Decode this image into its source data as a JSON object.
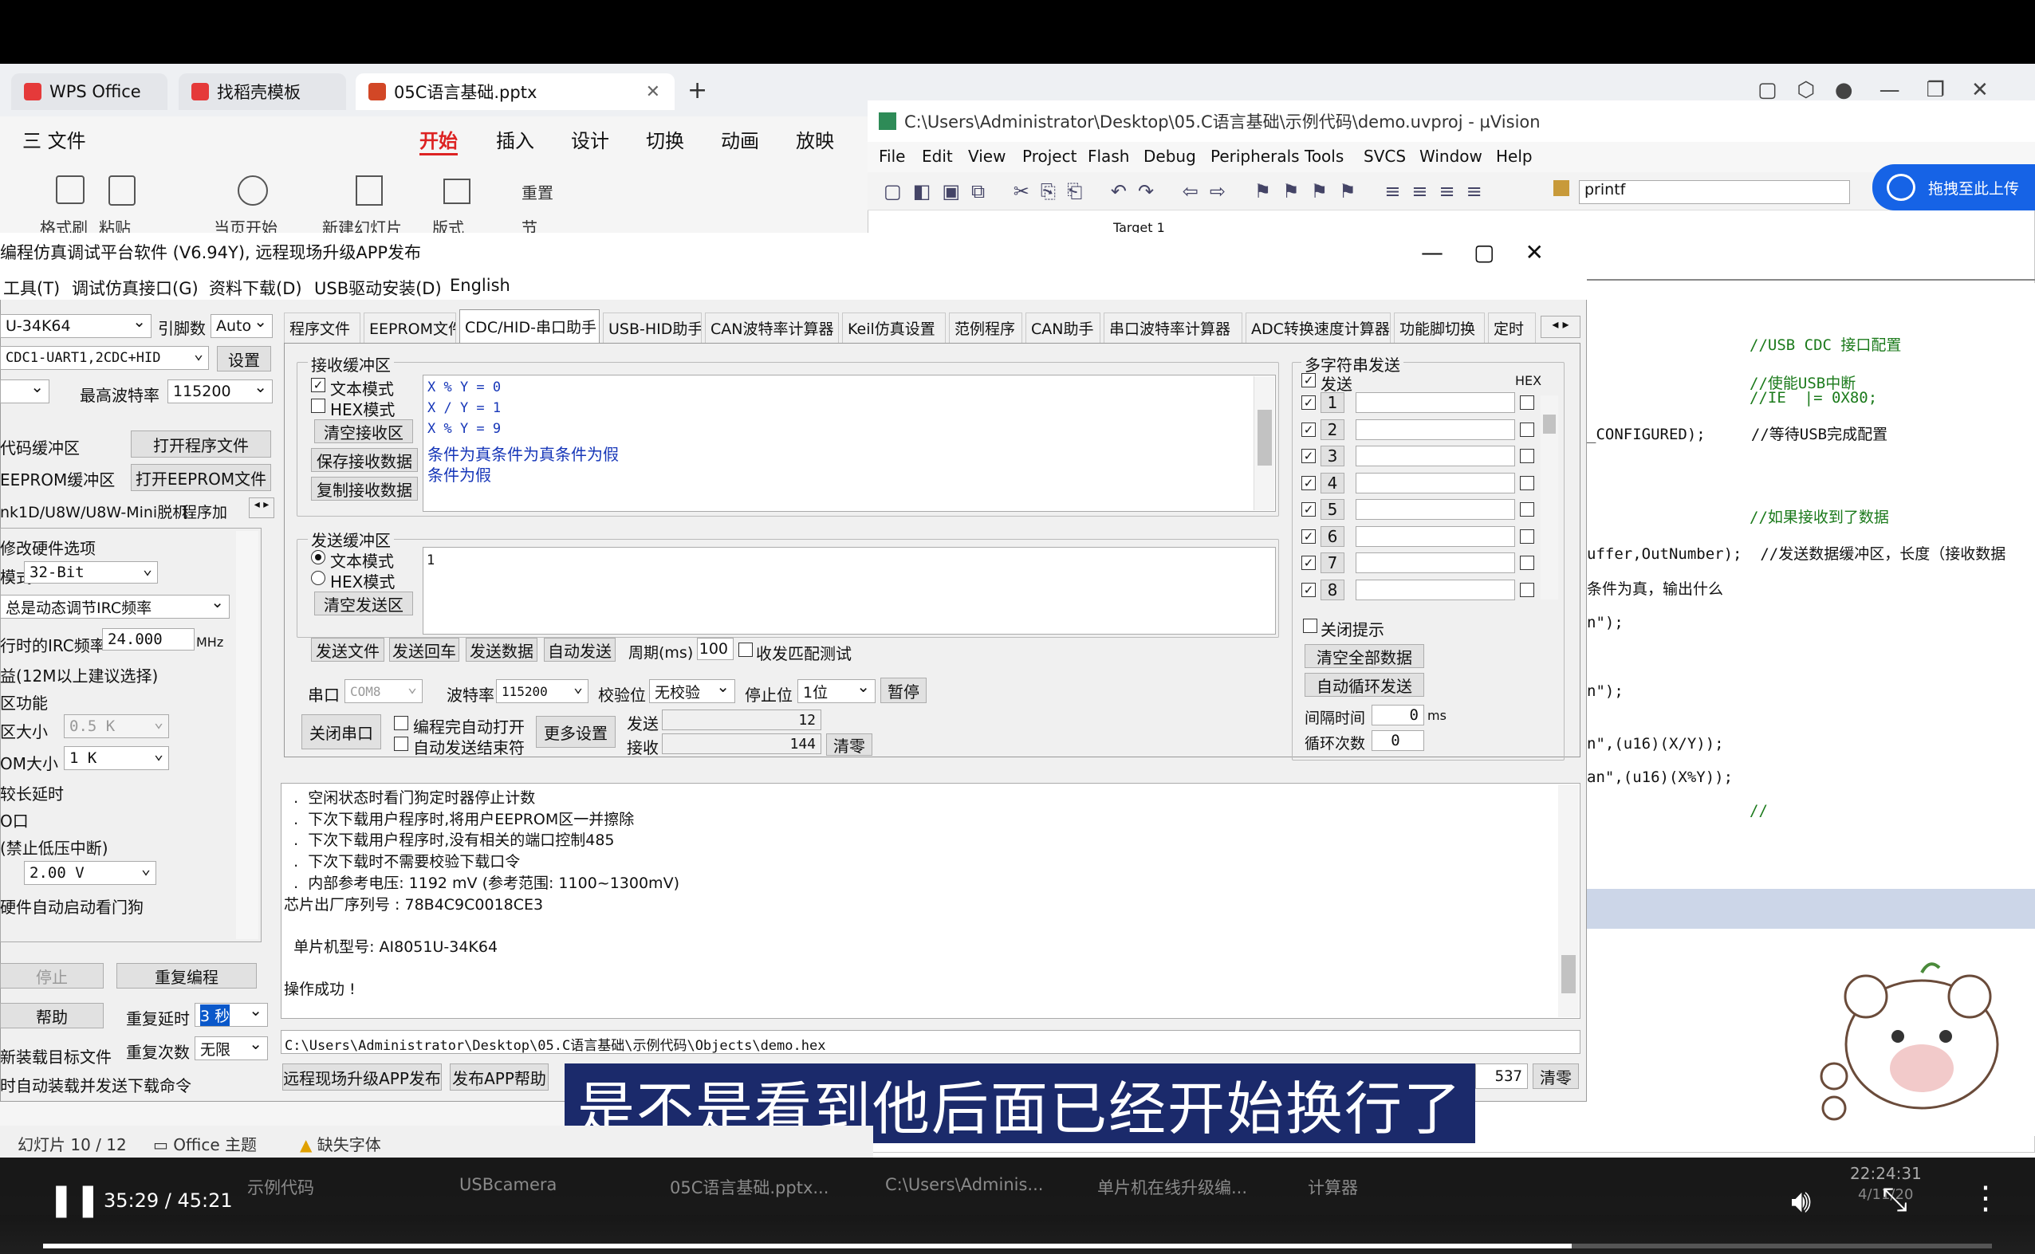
{
  "wps": {
    "tab1": "WPS Office",
    "tab2": "找稻壳模板",
    "tab3": "05C语言基础.pptx",
    "menu": [
      "三 文件",
      "开始",
      "插入",
      "设计",
      "切换",
      "动画",
      "放映"
    ],
    "ribbon": [
      "格式刷",
      "粘贴",
      "当页开始",
      "新建幻灯片",
      "版式",
      "重置",
      "节"
    ],
    "status_slide": "幻灯片 10 / 12",
    "status_theme": "Office 主题",
    "status_font": "缺失字体"
  },
  "uvision": {
    "title": "C:\\Users\\Administrator\\Desktop\\05.C语言基础\\示例代码\\demo.uvproj - µVision",
    "menu": [
      "File",
      "Edit",
      "View",
      "Project",
      "Flash",
      "Debug",
      "Peripherals",
      "Tools",
      "SVCS",
      "Window",
      "Help"
    ],
    "search": "printf",
    "target": "Target 1",
    "code": [
      {
        "text": "//USB CDC 接口配置",
        "cls": "cm"
      },
      {
        "text": "//使能USB中断",
        "cls": "cm"
      },
      {
        "text": "//IE  |= 0X80;",
        "cls": "cm"
      },
      {
        "text": "_CONFIGURED);     //等待USB完成配置",
        "cls": ""
      },
      {
        "text": "//如果接收到了数据",
        "cls": "cm"
      },
      {
        "text": "uffer,OutNumber);  //发送数据缓冲区，长度（接收数据",
        "cls": ""
      },
      {
        "text": "条件为真，输出什么",
        "cls": ""
      },
      {
        "text": "n\");",
        "cls": ""
      },
      {
        "text": "n\");",
        "cls": ""
      },
      {
        "text": "n\",(u16)(X/Y));",
        "cls": ""
      },
      {
        "text": "an\",(u16)(X%Y));",
        "cls": ""
      },
      {
        "text": "//",
        "cls": "cm"
      }
    ]
  },
  "baidu": "拖拽至此上传",
  "dialog": {
    "title": "编程仿真调试平台软件 (V6.94Y), 远程现场升级APP发布",
    "menu": [
      "工具(T)",
      "调试仿真接口(G)",
      "资料下载(D)",
      "USB驱动安装(D)",
      "English"
    ],
    "tabs": [
      "程序文件",
      "EEPROM文件",
      "CDC/HID-串口助手",
      "USB-HID助手",
      "CAN波特率计算器",
      "Keil仿真设置",
      "范例程序",
      "CAN助手",
      "串口波特率计算器",
      "ADC转换速度计算器",
      "功能脚切换",
      "定时"
    ],
    "left": {
      "mcu": "U-34K64",
      "pin_label": "引脚数",
      "pin_val": "Auto",
      "port": "CDC1-UART1,2CDC+HID",
      "settings": "设置",
      "maxbaud_label": "最高波特率",
      "maxbaud": "115200",
      "code_buf": "代码缓冲区",
      "open_prog": "打开程序文件",
      "eeprom_buf": "EEPROM缓冲区",
      "open_eeprom": "打开EEPROM文件",
      "ulink": "nk1D/U8W/U8W-Mini脱机",
      "prog_add": "程序加",
      "hw_opt": "修改硬件选项",
      "mode_label": "模式",
      "mode": "32-Bit",
      "irc": "总是动态调节IRC频率",
      "irc_label": "行时的IRC频率",
      "irc_val": "24.000",
      "mhz": "MHz",
      "gain": "益(12M以上建议选择)",
      "area": "区功能",
      "area_size": "区大小",
      "area_val": "0.5 K",
      "om_size": "OM大小",
      "om_val": "1  K",
      "long_delay": "较长延时",
      "io": "O口",
      "lvd": "(禁止低压中断)",
      "lvd_val": "2.00 V",
      "wdt": "硬件自动启动看门狗",
      "stop": "停止",
      "reprog": "重复编程",
      "help": "帮助",
      "rep_delay_label": "重复延时",
      "rep_delay": "3 秒",
      "rep_count_label": "重复次数",
      "rep_count": "无限",
      "reload": "新装载目标文件",
      "autoload": "时自动装载并发送下载命令"
    },
    "rx": {
      "label": "接收缓冲区",
      "text_mode": "文本模式",
      "hex_mode": "HEX模式",
      "clear": "清空接收区",
      "save": "保存接收数据",
      "copy": "复制接收数据",
      "lines": [
        {
          "t": "X % Y = 0",
          "c": "mono"
        },
        {
          "t": "X / Y = 1",
          "c": "mono"
        },
        {
          "t": "X % Y = 9",
          "c": "mono"
        },
        {
          "t": "条件为真条件为真条件为假",
          "c": ""
        },
        {
          "t": "条件为假",
          "c": ""
        }
      ]
    },
    "tx": {
      "label": "发送缓冲区",
      "text_mode": "文本模式",
      "hex_mode": "HEX模式",
      "clear": "清空发送区",
      "content": "1"
    },
    "buttons": {
      "send_file": "发送文件",
      "send_cr": "发送回车",
      "send_data": "发送数据",
      "auto_send": "自动发送",
      "period_label": "周期(ms)",
      "period": "100",
      "match": "收发匹配测试"
    },
    "serial": {
      "port_label": "串口",
      "port": "COM8",
      "baud_label": "波特率",
      "baud": "115200",
      "parity_label": "校验位",
      "parity": "无校验",
      "stop_label": "停止位",
      "stop": "1位",
      "pause": "暂停",
      "close": "关闭串口",
      "auto_open": "编程完自动打开",
      "auto_end": "自动发送结束符",
      "more": "更多设置",
      "sent_label": "发送",
      "sent": "12",
      "recv_label": "接收",
      "recv": "144",
      "zero": "清零"
    },
    "multi": {
      "label": "多字符串发送",
      "send": "发送",
      "hex": "HEX",
      "rows": [
        "1",
        "2",
        "3",
        "4",
        "5",
        "6",
        "7",
        "8"
      ],
      "close_tip": "关闭提示",
      "clear_all": "清空全部数据",
      "auto_loop": "自动循环发送",
      "interval_label": "间隔时间",
      "interval": "0",
      "ms": "ms",
      "loop_label": "循环次数",
      "loop": "0"
    },
    "log": [
      "  .  空闲状态时看门狗定时器停止计数",
      "  .  下次下载用户程序时,将用户EEPROM区一并擦除",
      "  .  下次下载用户程序时,没有相关的端口控制485",
      "  .  下次下载时不需要校验下载口令",
      "  .  内部参考电压: 1192 mV (参考范围: 1100~1300mV)",
      "芯片出厂序列号 : 78B4C9C0018CE3",
      "",
      "  单片机型号: AI8051U-34K64",
      "",
      "操作成功 !"
    ],
    "path": "C:\\Users\\Administrator\\Desktop\\05.C语言基础\\示例代码\\Objects\\demo.hex",
    "bottom": {
      "remote": "远程现场升级APP发布",
      "publish": "发布APP帮助",
      "count": "537",
      "clear": "清零"
    }
  },
  "subtitle": "是不是看到他后面已经开始换行了",
  "taskbar": [
    "示例代码",
    "USBcamera",
    "05C语言基础.pptx...",
    "C:\\Users\\Adminis...",
    "单片机在线升级编...",
    "计算器"
  ],
  "clock": "22:24:31",
  "date": "4/11/20",
  "video": {
    "time": "35:29 / 45:21",
    "progress": 0.7845
  }
}
